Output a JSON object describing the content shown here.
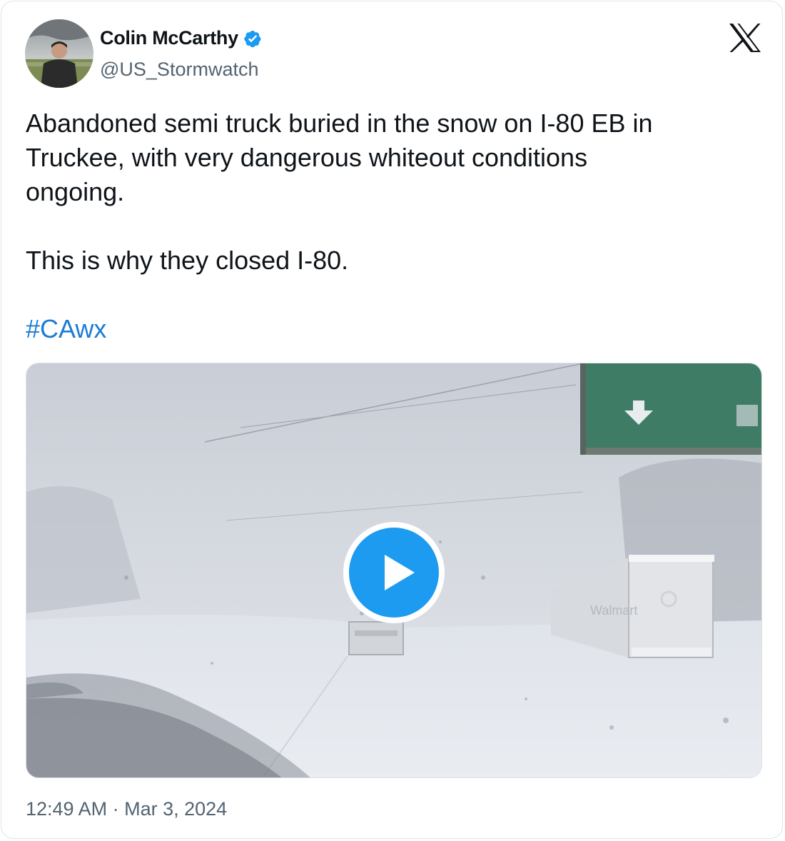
{
  "author": {
    "display_name": "Colin McCarthy",
    "handle": "@US_Stormwatch",
    "verified": true
  },
  "tweet": {
    "text_lines": [
      "Abandoned semi truck buried in the snow on I-80 EB in",
      "Truckee, with very dangerous whiteout conditions",
      "ongoing."
    ],
    "second_paragraph": "This is why they closed I-80.",
    "hashtag": "#CAwx"
  },
  "media": {
    "type": "video",
    "play_icon": "play-icon"
  },
  "timestamp": {
    "time": "12:49 AM",
    "separator": "·",
    "date": "Mar 3, 2024"
  },
  "icons": {
    "verified": "verified-badge-icon",
    "logo": "x-logo-icon"
  },
  "colors": {
    "text": "#0f1419",
    "secondary_text": "#536471",
    "link": "#1d7bd2",
    "accent": "#1d9bf0",
    "border": "#dfe3e6"
  }
}
